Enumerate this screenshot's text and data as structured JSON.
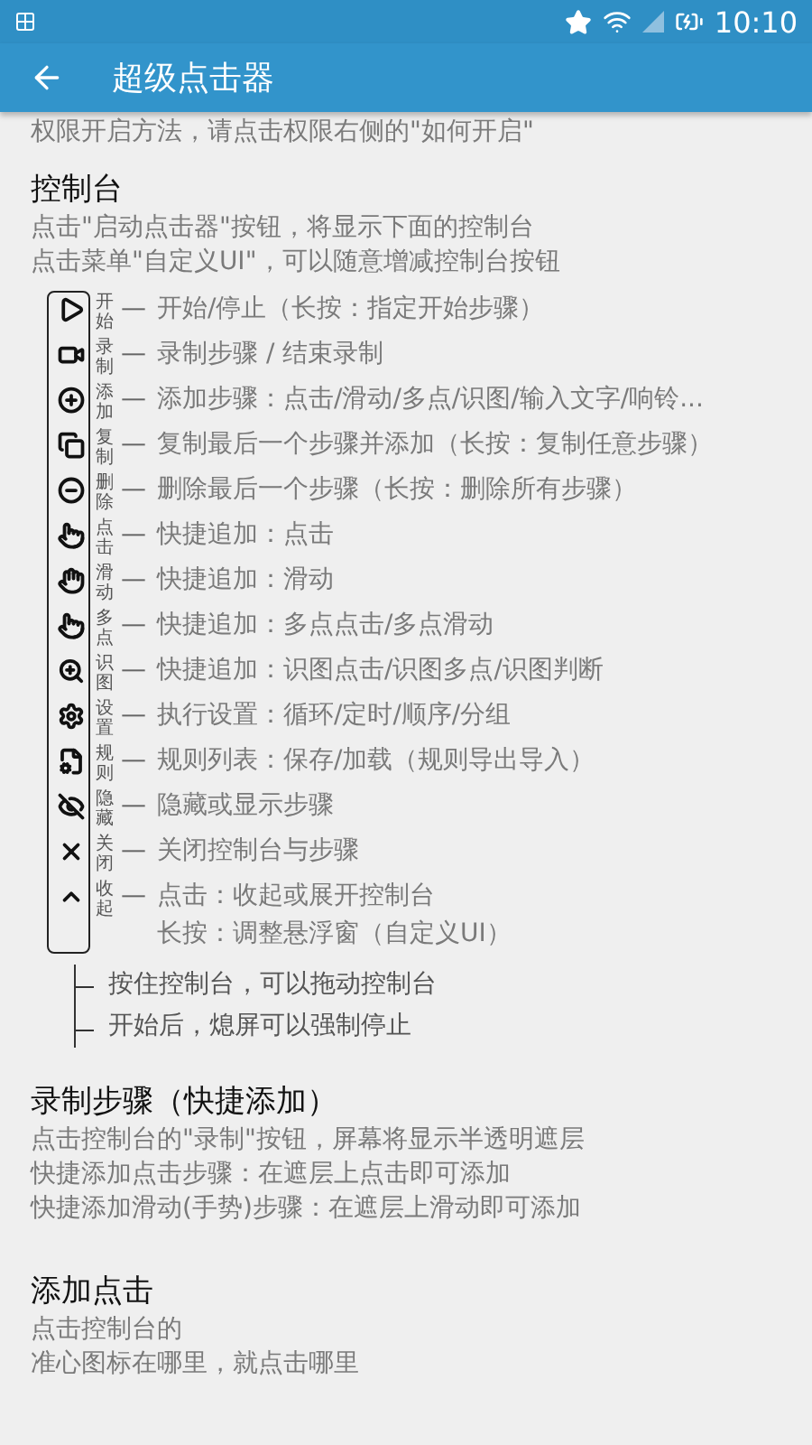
{
  "status_bar": {
    "time": "10:10"
  },
  "app_bar": {
    "title": "超级点击器"
  },
  "intro_line": "权限开启方法，请点击权限右侧的\"如何开启\"",
  "console": {
    "heading": "控制台",
    "lines": [
      "点击\"启动点击器\"按钮，将显示下面的控制台",
      "点击菜单\"自定义UI\"，可以随意增减控制台按钮"
    ],
    "items": [
      {
        "kind": "play",
        "tag": "开始",
        "dash": "—",
        "lines": [
          "开始/停止（长按：指定开始步骤）"
        ]
      },
      {
        "kind": "record",
        "tag": "录制",
        "dash": "—",
        "lines": [
          "录制步骤 / 结束录制"
        ]
      },
      {
        "kind": "add",
        "tag": "添加",
        "dash": "—",
        "lines": [
          "添加步骤：点击/滑动/多点/识图/输入文字/响铃..."
        ]
      },
      {
        "kind": "copy",
        "tag": "复制",
        "dash": "—",
        "lines": [
          "复制最后一个步骤并添加（长按：复制任意步骤）"
        ]
      },
      {
        "kind": "remove",
        "tag": "删除",
        "dash": "—",
        "lines": [
          "删除最后一个步骤（长按：删除所有步骤）"
        ]
      },
      {
        "kind": "tap",
        "tag": "点击",
        "dash": "—",
        "lines": [
          "快捷追加：点击"
        ]
      },
      {
        "kind": "swipe",
        "tag": "滑动",
        "dash": "—",
        "lines": [
          "快捷追加：滑动"
        ]
      },
      {
        "kind": "multi",
        "tag": "多点",
        "dash": "—",
        "lines": [
          "快捷追加：多点点击/多点滑动"
        ]
      },
      {
        "kind": "image",
        "tag": "识图",
        "dash": "—",
        "lines": [
          "快捷追加：识图点击/识图多点/识图判断"
        ]
      },
      {
        "kind": "settings",
        "tag": "设置",
        "dash": "—",
        "lines": [
          "执行设置：循环/定时/顺序/分组"
        ]
      },
      {
        "kind": "rules",
        "tag": "规则",
        "dash": "—",
        "lines": [
          "规则列表：保存/加载（规则导出导入）"
        ]
      },
      {
        "kind": "hide",
        "tag": "隐藏",
        "dash": "—",
        "lines": [
          "隐藏或显示步骤"
        ]
      },
      {
        "kind": "close",
        "tag": "关闭",
        "dash": "—",
        "lines": [
          "关闭控制台与步骤"
        ]
      },
      {
        "kind": "collapse",
        "tag": "收起",
        "dash": "—",
        "lines": [
          "点击：收起或展开控制台",
          "长按：调整悬浮窗（自定义UI）"
        ]
      }
    ],
    "notes": [
      "按住控制台，可以拖动控制台",
      "开始后，熄屏可以强制停止"
    ]
  },
  "sections": [
    {
      "heading": "录制步骤（快捷添加）",
      "lines": [
        "点击控制台的\"录制\"按钮，屏幕将显示半透明遮层",
        "快捷添加点击步骤：在遮层上点击即可添加",
        "快捷添加滑动(手势)步骤：在遮层上滑动即可添加"
      ]
    },
    {
      "heading": "添加点击",
      "lines": [
        "点击控制台的",
        "准心图标在哪里，就点击哪里"
      ]
    }
  ]
}
